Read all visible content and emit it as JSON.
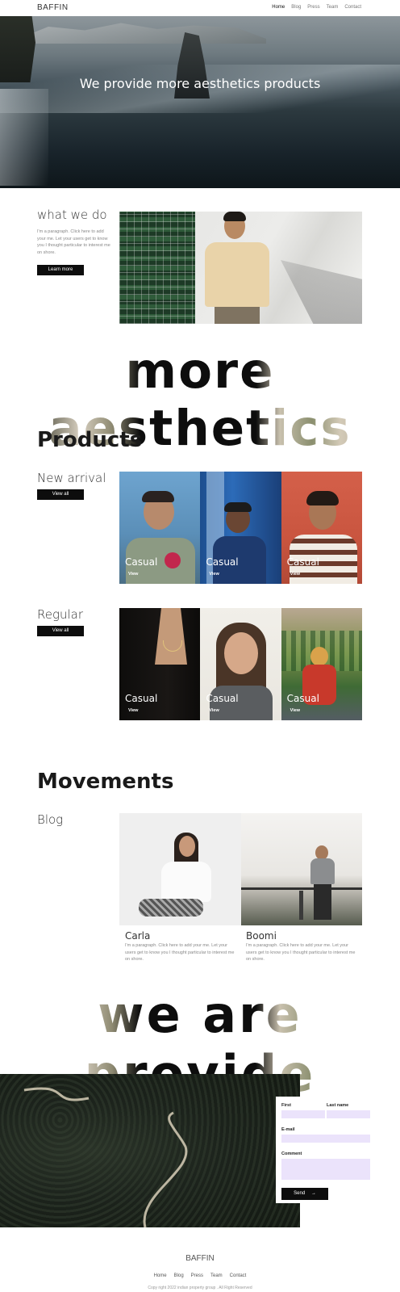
{
  "header": {
    "logo": "BAFFIN",
    "nav": [
      "Home",
      "Blog",
      "Press",
      "Team",
      "Contact"
    ],
    "active_nav": "Home"
  },
  "hero": {
    "title": "We provide more aesthetics products"
  },
  "what_we_do": {
    "title": "what we do",
    "text": "I'm a paragraph. Click here to add your me. Let your users get to know you I thought particular to interest me on shore.",
    "button": "Learn more"
  },
  "banner_1": "more aesthetics",
  "products": {
    "title": "Products",
    "groups": [
      {
        "title": "New arrival",
        "button": "View all",
        "tiles": [
          {
            "label": "Casual",
            "link": "View"
          },
          {
            "label": "Casual",
            "link": "View"
          },
          {
            "label": "Casual",
            "link": "View"
          }
        ]
      },
      {
        "title": "Regular",
        "button": "View all",
        "tiles": [
          {
            "label": "Casual",
            "link": "View"
          },
          {
            "label": "Casual",
            "link": "View"
          },
          {
            "label": "Casual",
            "link": "View"
          }
        ]
      }
    ]
  },
  "movements": {
    "title": "Movements",
    "subtitle": "Blog",
    "posts": [
      {
        "name": "Carla",
        "text": "I'm a paragraph. Click here to add your me. Let your users get to know you I thought particular to interest me on shore."
      },
      {
        "name": "Boomi",
        "text": "I'm a paragraph. Click here to add your me. Let your users get to know you I thought particular to interest me on shore."
      }
    ]
  },
  "banner_2": "we are provide",
  "contact_form": {
    "first_label": "First",
    "last_label": "Last name",
    "email_label": "E-mail",
    "comment_label": "Comment",
    "send_label": "Send",
    "send_icon": "→",
    "input_color": "#ebe3fb"
  },
  "footer": {
    "logo": "BAFFIN",
    "nav": [
      "Home",
      "Blog",
      "Press",
      "Team",
      "Contact"
    ],
    "copyright": "Copy right 2022 indian property group . All Right Reserved"
  },
  "colors": {
    "accent": "#0d0d0d",
    "text": "#1a1a1a",
    "muted": "#888888"
  }
}
